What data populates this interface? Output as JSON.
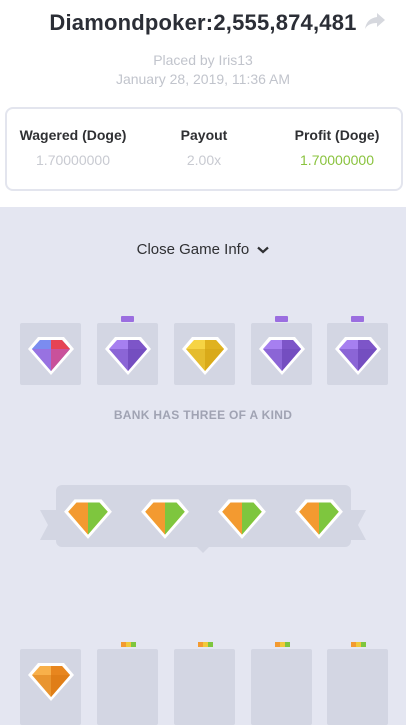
{
  "header": {
    "title": "Diamondpoker:2,555,874,481",
    "placed_by": "Placed by Iris13",
    "date": "January 28, 2019, 11:36 AM"
  },
  "stats": [
    {
      "label": "Wagered (Doge)",
      "value": "1.70000000"
    },
    {
      "label": "Payout",
      "value": "2.00x"
    },
    {
      "label": "Profit (Doge)",
      "value": "1.70000000"
    }
  ],
  "game": {
    "close_label": "Close Game Info",
    "bank_message": "BANK HAS THREE OF A KIND",
    "bank_gems": [
      "multicolor",
      "purple",
      "yellow",
      "purple",
      "purple"
    ],
    "player_hand_gems": [
      "yellow-orange-green",
      "yellow-orange-green",
      "yellow-orange-green",
      "yellow-orange-green"
    ],
    "player_gems": [
      "orange",
      "empty",
      "empty",
      "empty",
      "empty"
    ]
  },
  "colors": {
    "profit": "#8ac33e",
    "purple": "#9b6ee0",
    "yellow": "#f1c93a",
    "orange": "#f39a30",
    "green": "#7ec63e",
    "red": "#e64355",
    "blue": "#5ab2f0"
  }
}
